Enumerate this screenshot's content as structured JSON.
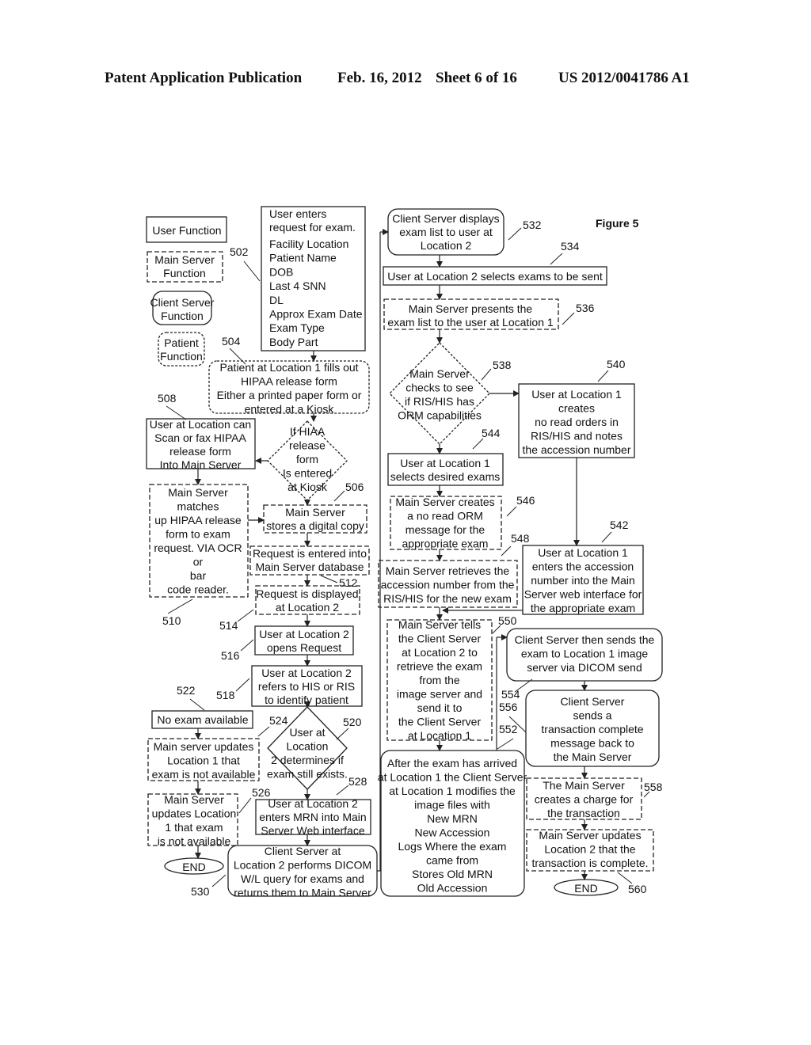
{
  "header": {
    "publication": "Patent Application Publication",
    "date": "Feb. 16, 2012",
    "sheet": "Sheet 6 of 16",
    "number": "US 2012/0041786 A1"
  },
  "figure_label": "Figure 5",
  "legend": {
    "user": "User Function",
    "main_server": [
      "Main Server",
      "Function"
    ],
    "client_server": [
      "Client Server",
      "Function"
    ],
    "patient": [
      "Patient",
      "Function"
    ]
  },
  "nodes": {
    "n502": {
      "ref": "502",
      "lines": [
        "User enters",
        "request for exam.",
        "Facility Location",
        "Patient Name",
        "DOB",
        "Last 4 SNN",
        "DL",
        "Approx Exam Date",
        "Exam Type",
        "Body Part"
      ]
    },
    "n504": {
      "ref": "504",
      "lines": [
        "Patient at Location 1 fills out",
        "HIPAA release form",
        "Either a printed paper form or",
        "entered at a Kiosk"
      ]
    },
    "n508": {
      "ref": "508",
      "lines": [
        "User at Location can",
        "Scan or fax HIPAA",
        "release form",
        "Into Main Server"
      ]
    },
    "dec_hipaa": {
      "lines": [
        "If HIAA",
        "release",
        "form",
        "Is entered",
        "at Kiosk"
      ]
    },
    "n506": {
      "ref": "506",
      "lines": [
        "Main Server",
        "stores a digital copy"
      ]
    },
    "n510": {
      "ref": "510",
      "lines": [
        "Main Server",
        "matches",
        "up HIPAA release",
        "form to exam",
        "request. VIA OCR",
        "or",
        "bar",
        "code reader."
      ]
    },
    "n512": {
      "ref": "512",
      "lines": [
        "Request is entered into",
        "Main Server database"
      ]
    },
    "n514": {
      "ref": "514",
      "lines": [
        "Request is displayed",
        "at Location 2"
      ]
    },
    "n516": {
      "ref": "516",
      "lines": [
        "User at Location 2",
        "opens Request"
      ]
    },
    "n518": {
      "ref": "518",
      "lines": [
        "User at Location 2",
        "refers to HIS or RIS",
        "to identify patient"
      ]
    },
    "n522": {
      "ref": "522",
      "lines": [
        "No exam available"
      ]
    },
    "n520": {
      "ref": "520",
      "lines": [
        "User at",
        "Location",
        "2 determines if",
        "exam still exists."
      ]
    },
    "n524": {
      "ref": "524",
      "lines": [
        "Main server updates",
        "Location 1 that",
        "exam is not available"
      ]
    },
    "n526": {
      "ref": "526",
      "lines": [
        "Main Server",
        "updates Location",
        "1 that exam",
        "is not available"
      ]
    },
    "n528": {
      "ref": "528",
      "lines": [
        "User at Location 2",
        "enters MRN into Main",
        "Server Web interface"
      ]
    },
    "n530": {
      "ref": "530",
      "lines": [
        "Client Server at",
        "Location 2 performs DICOM",
        "W/L query for exams and",
        "returns them to Main Server"
      ]
    },
    "end_left": {
      "label": "END"
    },
    "n532": {
      "ref": "532",
      "lines": [
        "Client Server displays",
        "exam list to user at",
        "Location 2"
      ]
    },
    "n534": {
      "ref": "534",
      "lines": [
        "User at Location 2 selects exams to be sent"
      ]
    },
    "n536": {
      "ref": "536",
      "lines": [
        "Main Server presents the",
        "exam list to the user at Location 1"
      ]
    },
    "n538": {
      "ref": "538",
      "lines": [
        "Main Server",
        "checks to see",
        "if RIS/HIS has",
        "ORM capabilities"
      ]
    },
    "n540": {
      "ref": "540",
      "lines": [
        "User at Location 1",
        "creates",
        "no read orders in",
        "RIS/HIS and notes",
        "the accession number"
      ]
    },
    "n544": {
      "ref": "544",
      "lines": [
        "User at Location 1",
        "selects desired exams"
      ]
    },
    "n546": {
      "ref": "546",
      "lines": [
        "Main Server creates",
        "a no read ORM",
        "message for the",
        "appropriate exam"
      ]
    },
    "n542": {
      "ref": "542",
      "lines": [
        "User at Location 1",
        "enters the accession",
        "number into the Main",
        "Server web interface for",
        "the appropriate exam"
      ]
    },
    "n548": {
      "ref": "548",
      "lines": [
        "Main Server retrieves the",
        "accession number from the",
        "RIS/HIS for the new exam"
      ]
    },
    "n550": {
      "ref": "550",
      "lines": [
        "Main Server tells",
        "the Client Server",
        "at Location 2 to",
        "retrieve  the exam",
        "from the",
        "image server and",
        "send it to",
        "the Client Server",
        "at Location 1"
      ]
    },
    "n554": {
      "ref": "554",
      "lines": [
        "Client Server then sends the",
        "exam to Location 1 image",
        "server via DICOM send"
      ]
    },
    "n556": {
      "ref": "556",
      "lines": [
        "Client Server",
        "sends a",
        "transaction complete",
        "message back to",
        "the Main Server"
      ]
    },
    "n552": {
      "ref": "552",
      "lines": [
        "After the exam has arrived",
        "at Location 1 the Client Server",
        "at Location 1 modifies the",
        "image files with",
        "New   MRN",
        "New   Accession",
        "Logs   Where the exam",
        "came from",
        "Stores   Old MRN",
        "Old Accession"
      ]
    },
    "n558": {
      "ref": "558",
      "lines": [
        "The Main Server",
        "creates a charge for",
        "the transaction"
      ]
    },
    "n560": {
      "ref": "560",
      "lines": [
        "Main Server updates",
        "Location 2 that the",
        "transaction is complete."
      ]
    },
    "end_right": {
      "label": "END"
    }
  }
}
